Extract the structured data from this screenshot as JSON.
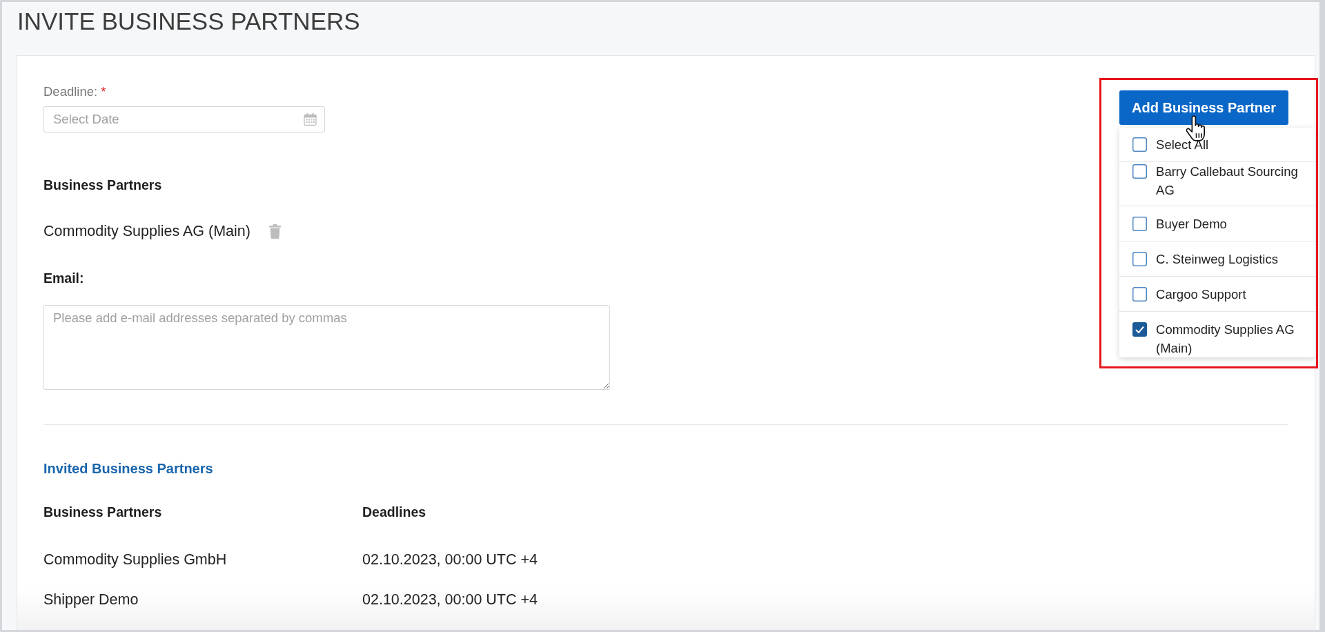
{
  "page": {
    "title": "INVITE BUSINESS PARTNERS"
  },
  "deadline": {
    "label": "Deadline:",
    "required_mark": "*",
    "placeholder": "Select Date"
  },
  "business_partners": {
    "heading": "Business Partners",
    "partners": [
      {
        "name": "Commodity Supplies AG (Main)"
      }
    ]
  },
  "email": {
    "label": "Email:",
    "placeholder": "Please add e-mail addresses separated by commas"
  },
  "add_button": {
    "label": "Add Business Partner"
  },
  "partner_menu": {
    "select_all": {
      "label": "Select All",
      "checked": false
    },
    "items": [
      {
        "label": "Barry Callebaut Sourcing AG",
        "checked": false
      },
      {
        "label": "Buyer Demo",
        "checked": false
      },
      {
        "label": "C. Steinweg Logistics",
        "checked": false
      },
      {
        "label": "Cargoo Support",
        "checked": false
      },
      {
        "label": "Commodity Supplies AG (Main)",
        "checked": true
      }
    ]
  },
  "invited": {
    "title": "Invited Business Partners",
    "columns": [
      "Business Partners",
      "Deadlines"
    ],
    "rows": [
      {
        "partner": "Commodity Supplies GmbH",
        "deadline": "02.10.2023, 00:00 UTC +4"
      },
      {
        "partner": "Shipper Demo",
        "deadline": "02.10.2023, 00:00 UTC +4"
      }
    ]
  }
}
